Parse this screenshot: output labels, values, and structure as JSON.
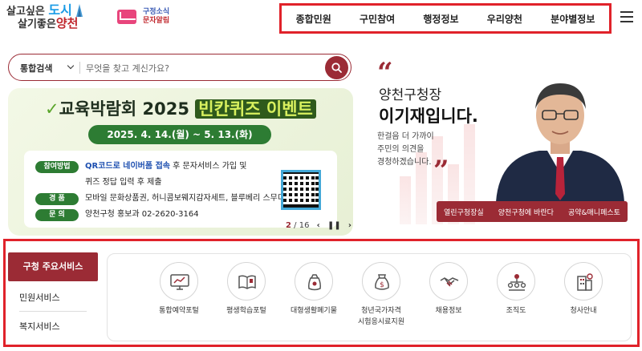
{
  "header": {
    "logo_line1_prefix": "살고싶은",
    "logo_line1_emph": "도시",
    "logo_line2_prefix": "살기좋은",
    "logo_line2_emph": "양천",
    "news_line1": "구정소식",
    "news_line2": "문자알림"
  },
  "gnb": [
    "종합민원",
    "구민참여",
    "행정정보",
    "우리양천",
    "분야별정보"
  ],
  "search": {
    "category": "통합검색",
    "placeholder": "무엇을 찾고 계신가요?"
  },
  "banner": {
    "title_prefix": "교육박람회 2025",
    "title_highlight": "빈칸퀴즈 이벤트",
    "dates": "2025. 4. 14.(월) ~ 5. 13.(화)",
    "rows": [
      {
        "tag": "참여방법",
        "emph": "QR코드로 네이버폼 접속",
        "text": " 후 문자서비스 가입 및"
      },
      {
        "tag": "",
        "emph": "",
        "text": "퀴즈 정답 입력 후 제출"
      },
      {
        "tag": "경   품",
        "emph": "",
        "text": "모바일 문화상품권, 허니콤보웨지감자세트, 블루베리 스무디"
      },
      {
        "tag": "문   의",
        "emph": "",
        "text": "양천구청 홍보과 02-2620-3164"
      }
    ],
    "pager_current": "2",
    "pager_total": "/ 16"
  },
  "mayor": {
    "title_line1": "양천구청장",
    "title_line2": "이기재입니다.",
    "desc": [
      "한걸음 더 가까이",
      "주민의 의견을",
      "경청하겠습니다."
    ],
    "links": [
      "열린구청장실",
      "양천구청에 바란다",
      "공약&매니페스토"
    ]
  },
  "services": {
    "tab_active": "구청 주요서비스",
    "tabs": [
      "민원서비스",
      "복지서비스"
    ],
    "items": [
      {
        "label": "통합예약포털",
        "icon": "monitor-chart-icon"
      },
      {
        "label": "평생학습포털",
        "icon": "open-book-icon"
      },
      {
        "label": "대형생활폐기물",
        "icon": "waste-bag-icon"
      },
      {
        "label": "청년국가자격\n시험응시료지원",
        "icon": "money-bag-icon"
      },
      {
        "label": "채용정보",
        "icon": "handshake-icon"
      },
      {
        "label": "조직도",
        "icon": "org-chart-icon"
      },
      {
        "label": "청사안내",
        "icon": "building-icon"
      }
    ]
  },
  "colors": {
    "brand": "#9b2b35",
    "highlight_box": "#e0222a",
    "banner_green": "#2d7c33"
  }
}
